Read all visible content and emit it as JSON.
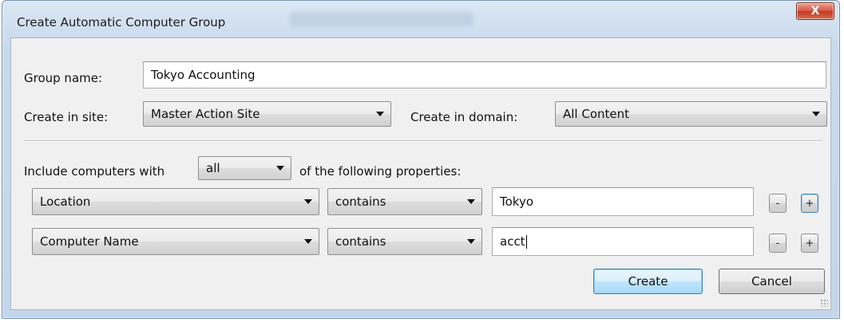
{
  "window": {
    "title": "Create Automatic Computer Group",
    "close_label": "X"
  },
  "form": {
    "group_name_label": "Group name:",
    "group_name_value": "Tokyo Accounting",
    "site_label": "Create in site:",
    "site_value": "Master Action Site",
    "domain_label": "Create in domain:",
    "domain_value": "All Content",
    "include_prefix": "Include computers with",
    "include_mode": "all",
    "include_suffix": "of the following properties:"
  },
  "rules": [
    {
      "property": "Location",
      "operator": "contains",
      "value": "Tokyo",
      "remove_label": "-",
      "add_label": "+"
    },
    {
      "property": "Computer Name",
      "operator": "contains",
      "value": "acct",
      "remove_label": "-",
      "add_label": "+"
    }
  ],
  "buttons": {
    "create": "Create",
    "cancel": "Cancel"
  },
  "icons": {
    "close": "close-icon",
    "dropdown": "chevron-down-icon",
    "resize": "resize-grip-icon"
  },
  "colors": {
    "close_button": "#d7563f",
    "default_button": "#bee6fd",
    "frame": "#c8d9ec"
  }
}
